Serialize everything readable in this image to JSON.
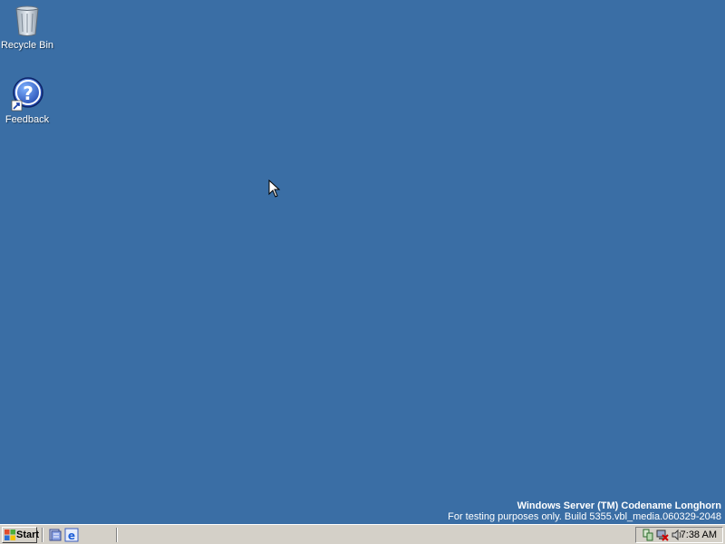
{
  "desktop": {
    "background_color": "#3a6ea5",
    "icons": [
      {
        "label": "Recycle Bin",
        "icon": "recycle-bin-icon"
      },
      {
        "label": "Feedback",
        "icon": "help-question-icon"
      }
    ],
    "watermark": {
      "title": "Windows Server (TM) Codename Longhorn",
      "subtitle": "For testing purposes only. Build 5355.vbl_media.060329-2048"
    }
  },
  "taskbar": {
    "start_label": "Start",
    "quick_launch": [
      "server-manager-icon",
      "internet-explorer-icon"
    ],
    "tray_icons": [
      "network-icon",
      "network-disconnected-icon",
      "volume-icon"
    ],
    "clock": "7:38 AM"
  }
}
